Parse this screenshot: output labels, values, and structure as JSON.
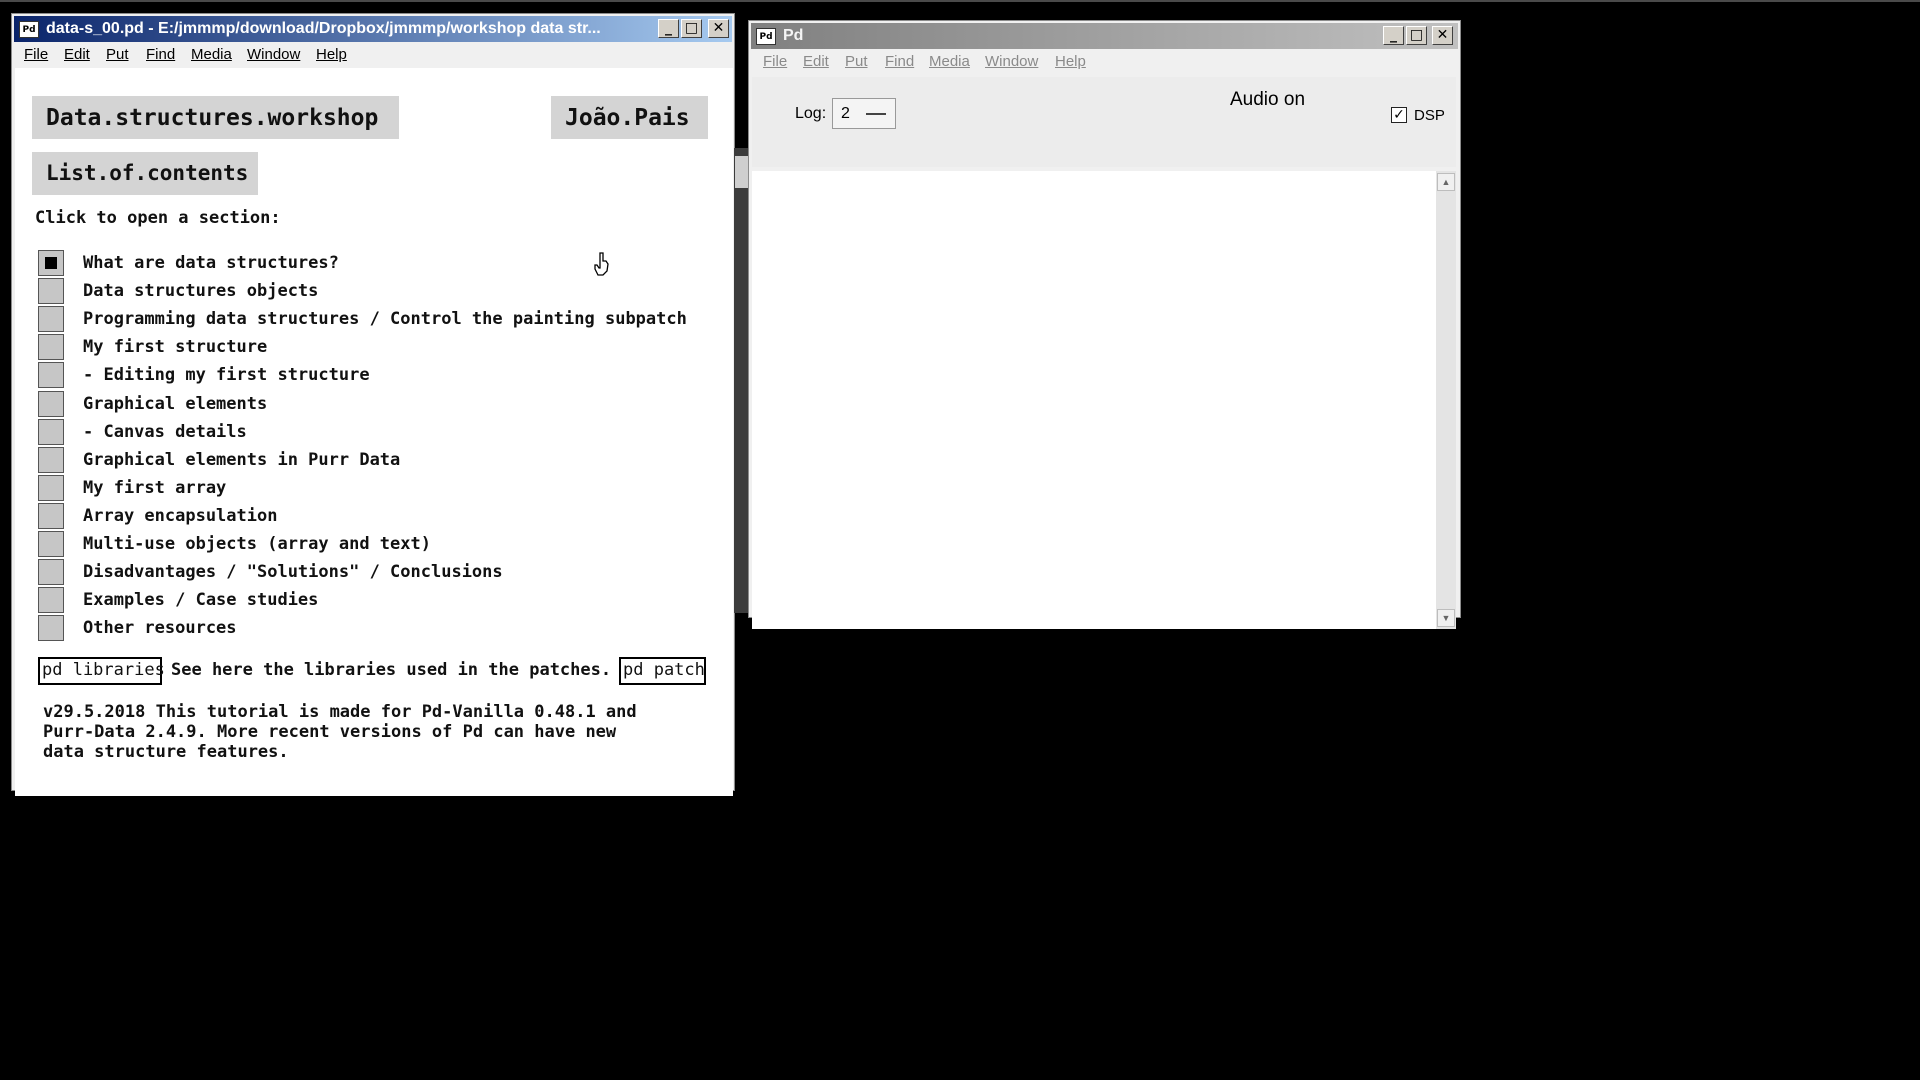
{
  "patch_window": {
    "title": "data-s_00.pd  - E:/jmmmp/download/Dropbox/jmmmp/workshop data str...",
    "app_icon": "Pd",
    "menu": [
      "File",
      "Edit",
      "Put",
      "Find",
      "Media",
      "Window",
      "Help"
    ],
    "heading": "Data.structures.workshop",
    "author": "João.Pais",
    "subheading": "List.of.contents",
    "intro": "Click to open a section:",
    "sections": [
      {
        "label": "What are data structures?",
        "checked": true
      },
      {
        "label": "Data structures objects",
        "checked": false
      },
      {
        "label": "Programming data structures / Control the painting subpatch",
        "checked": false
      },
      {
        "label": "My first structure",
        "checked": false
      },
      {
        "label": "- Editing my first structure",
        "checked": false
      },
      {
        "label": "Graphical elements",
        "checked": false
      },
      {
        "label": "- Canvas details",
        "checked": false
      },
      {
        "label": "Graphical elements in Purr Data",
        "checked": false
      },
      {
        "label": "My first array",
        "checked": false
      },
      {
        "label": "Array encapsulation",
        "checked": false
      },
      {
        "label": "Multi-use objects (array and text)",
        "checked": false
      },
      {
        "label": "Disadvantages / \"Solutions\" / Conclusions",
        "checked": false
      },
      {
        "label": "Examples / Case studies",
        "checked": false
      },
      {
        "label": "Other resources",
        "checked": false
      }
    ],
    "libraries_object": "pd libraries",
    "libraries_comment": "See here the libraries used in the patches.",
    "patch_object": "pd patch",
    "version_note": "v29.5.2018 This tutorial is made for Pd-Vanilla 0.48.1 and\nPurr-Data 2.4.9. More recent versions of Pd can have new\ndata structure features."
  },
  "pd_window": {
    "title": "Pd",
    "app_icon": "Pd",
    "menu": [
      "File",
      "Edit",
      "Put",
      "Find",
      "Media",
      "Window",
      "Help"
    ],
    "log_label": "Log:",
    "log_value": "2",
    "audio_status": "Audio on",
    "dsp_label": "DSP",
    "dsp_checked": true
  },
  "window_controls": {
    "minimize": "_",
    "maximize": "□",
    "close": "✕"
  },
  "icons": {
    "cursor": "hand-pointer-icon",
    "dsp_check": "✓"
  }
}
